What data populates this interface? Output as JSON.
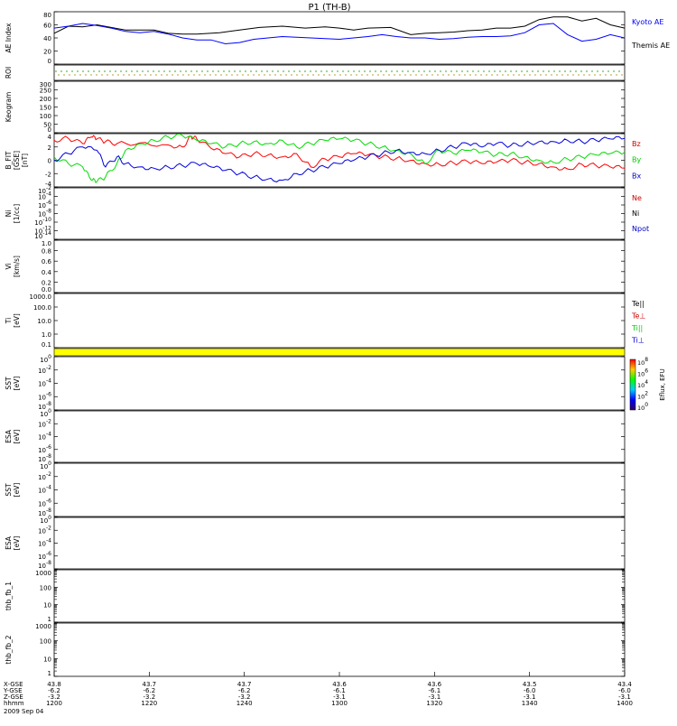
{
  "title": "P1 (TH-B)",
  "chart_data": {
    "type": "line",
    "x_range": [
      1200,
      1400
    ],
    "panels": [
      {
        "ylabel": [
          "AE Index"
        ],
        "kind": "ae",
        "ticks": [
          "80",
          "60",
          "40",
          "20",
          "0"
        ],
        "legend": [
          {
            "label": "Kyoto AE",
            "color": "#0000ff"
          },
          {
            "label": "Themis AE",
            "color": "#000000"
          }
        ],
        "series": [
          {
            "color": "#000000",
            "x": [
              1200,
              1205,
              1210,
              1215,
              1225,
              1235,
              1240,
              1245,
              1250,
              1258,
              1265,
              1272,
              1280,
              1288,
              1295,
              1300,
              1305,
              1310,
              1318,
              1325,
              1330,
              1335,
              1340,
              1345,
              1350,
              1355,
              1360,
              1365,
              1370,
              1375,
              1380,
              1385,
              1390,
              1395,
              1400
            ],
            "y": [
              47,
              58,
              57,
              60,
              52,
              52,
              47,
              46,
              46,
              48,
              52,
              56,
              58,
              55,
              57,
              55,
              52,
              55,
              56,
              45,
              47,
              48,
              49,
              51,
              52,
              55,
              55,
              58,
              68,
              72,
              72,
              66,
              70,
              60,
              55
            ]
          },
          {
            "color": "#0000ff",
            "x": [
              1200,
              1205,
              1210,
              1215,
              1220,
              1225,
              1230,
              1235,
              1240,
              1245,
              1250,
              1255,
              1260,
              1265,
              1270,
              1275,
              1280,
              1285,
              1290,
              1295,
              1300,
              1305,
              1310,
              1315,
              1320,
              1325,
              1330,
              1335,
              1340,
              1345,
              1350,
              1355,
              1360,
              1365,
              1370,
              1375,
              1380,
              1385,
              1390,
              1395,
              1400
            ],
            "y": [
              55,
              58,
              62,
              59,
              55,
              50,
              48,
              50,
              46,
              40,
              37,
              37,
              31,
              33,
              38,
              40,
              42,
              41,
              40,
              39,
              38,
              40,
              42,
              45,
              42,
              40,
              40,
              38,
              39,
              41,
              42,
              42,
              43,
              48,
              60,
              62,
              45,
              35,
              38,
              45,
              40
            ]
          }
        ]
      },
      {
        "ylabel": [
          "ROI"
        ],
        "kind": "roi"
      },
      {
        "ylabel": [
          "Keogram"
        ],
        "kind": "keogram",
        "ticks": [
          "300",
          "250",
          "200",
          "150",
          "100",
          "50",
          "0"
        ]
      },
      {
        "ylabel": [
          "B_FIT",
          "[GSE]",
          "[nT]"
        ],
        "kind": "bfit",
        "ticks": [
          "4",
          "2",
          "0",
          "-2",
          "-4"
        ],
        "legend": [
          {
            "label": "Bz",
            "color": "#cc0000"
          },
          {
            "label": "By",
            "color": "#00cc00"
          },
          {
            "label": "Bx",
            "color": "#0000cc"
          }
        ],
        "series": [
          {
            "color": "#ff0000",
            "x": [
              1200,
              1205,
              1210,
              1213,
              1215,
              1218,
              1222,
              1230,
              1240,
              1245,
              1248,
              1250,
              1255,
              1260,
              1265,
              1270,
              1275,
              1280,
              1285,
              1290,
              1295,
              1300,
              1305,
              1310,
              1315,
              1320,
              1325,
              1330,
              1335,
              1340,
              1345,
              1350,
              1355,
              1360,
              1365,
              1370,
              1375,
              1380,
              1385,
              1390,
              1395,
              1400
            ],
            "y": [
              3.0,
              3.3,
              2.5,
              3.5,
              3.2,
              2.8,
              2.5,
              2.6,
              2.3,
              2.0,
              3.6,
              3.2,
              1.8,
              1.0,
              0.5,
              1.0,
              0.8,
              0.5,
              1.0,
              -1.0,
              0.2,
              0.5,
              1.0,
              0.8,
              0.5,
              0.3,
              0.0,
              -0.5,
              -0.6,
              -0.4,
              -0.2,
              -0.5,
              -0.3,
              0.0,
              -0.3,
              -0.5,
              -1.0,
              -1.3,
              -0.6,
              -0.8,
              -1.0,
              -1.2
            ]
          },
          {
            "color": "#00dd00",
            "x": [
              1200,
              1205,
              1210,
              1213,
              1215,
              1218,
              1222,
              1225,
              1230,
              1235,
              1240,
              1245,
              1250,
              1255,
              1260,
              1265,
              1270,
              1275,
              1280,
              1285,
              1290,
              1295,
              1300,
              1305,
              1310,
              1315,
              1320,
              1325,
              1330,
              1335,
              1340,
              1345,
              1350,
              1355,
              1360,
              1365,
              1370,
              1375,
              1380,
              1385,
              1390,
              1395,
              1400
            ],
            "y": [
              0.5,
              -0.5,
              -1.0,
              -3.0,
              -3.2,
              -2.5,
              -0.5,
              1.5,
              2.5,
              3.0,
              3.5,
              3.7,
              3.0,
              2.5,
              2.0,
              2.5,
              2.8,
              2.5,
              3.0,
              2.0,
              2.5,
              3.0,
              3.2,
              3.0,
              2.5,
              2.0,
              1.5,
              1.0,
              -0.5,
              1.5,
              1.0,
              1.5,
              1.2,
              0.8,
              1.0,
              0.5,
              0.0,
              -0.3,
              0.2,
              0.5,
              0.8,
              1.0,
              1.2
            ]
          },
          {
            "color": "#0000dd",
            "x": [
              1200,
              1205,
              1210,
              1215,
              1218,
              1222,
              1225,
              1230,
              1235,
              1240,
              1245,
              1250,
              1255,
              1260,
              1265,
              1270,
              1275,
              1280,
              1285,
              1290,
              1295,
              1300,
              1305,
              1310,
              1315,
              1320,
              1325,
              1330,
              1335,
              1340,
              1345,
              1350,
              1355,
              1360,
              1365,
              1370,
              1375,
              1380,
              1385,
              1390,
              1395,
              1400
            ],
            "y": [
              0.0,
              1.0,
              2.0,
              1.5,
              -1.0,
              0.5,
              -0.5,
              -1.0,
              -1.2,
              -1.0,
              -0.8,
              -0.5,
              -1.0,
              -1.5,
              -2.0,
              -2.5,
              -2.8,
              -3.0,
              -2.0,
              -1.5,
              -1.0,
              -0.5,
              0.0,
              0.5,
              1.0,
              1.5,
              1.2,
              1.0,
              1.5,
              2.0,
              2.5,
              2.0,
              2.5,
              2.2,
              2.5,
              2.8,
              2.8,
              3.0,
              2.8,
              3.0,
              3.2,
              3.3
            ]
          }
        ]
      },
      {
        "ylabel": [
          "Ni",
          "[1/cc]"
        ],
        "kind": "ni",
        "ticks": [
          "10^{-2}",
          "10^{-4}",
          "10^{-6}",
          "10^{-8}",
          "10^{-10}",
          "10^{-12}",
          "10^{-14}"
        ],
        "legend": [
          {
            "label": "Ne",
            "color": "#cc0000"
          },
          {
            "label": "Ni",
            "color": "#000000"
          },
          {
            "label": "Npot",
            "color": "#0000cc"
          }
        ]
      },
      {
        "ylabel": [
          "Vi",
          "[km/s]"
        ],
        "kind": "vi",
        "ticks": [
          "1.0",
          "0.8",
          "0.6",
          "0.4",
          "0.2",
          "0.0"
        ]
      },
      {
        "ylabel": [
          "Ti",
          "[eV]"
        ],
        "kind": "ti",
        "ticks": [
          "1000.0",
          "100.0",
          "10.0",
          "1.0",
          "0.1"
        ],
        "legend": [
          {
            "label": "Te||",
            "color": "#000000"
          },
          {
            "label": "Te⊥",
            "color": "#cc0000"
          },
          {
            "label": "Ti||",
            "color": "#00cc00"
          },
          {
            "label": "Ti⊥",
            "color": "#0000cc"
          }
        ]
      },
      {
        "kind": "bar"
      },
      {
        "ylabel": [
          "SST",
          "[eV]"
        ],
        "kind": "spec",
        "ticks": [
          "10^{0}",
          "10^{-2}",
          "10^{-4}",
          "10^{-6}",
          "10^{-8}"
        ],
        "colorbar": {
          "label": "Eflux, EFU",
          "ticks": [
            "10^{8}",
            "10^{6}",
            "10^{4}",
            "10^{2}",
            "10^{0}"
          ]
        }
      },
      {
        "ylabel": [
          "ESA",
          "[eV]"
        ],
        "kind": "spec",
        "ticks": [
          "10^{0}",
          "10^{-2}",
          "10^{-4}",
          "10^{-6}",
          "10^{-8}"
        ]
      },
      {
        "ylabel": [
          "SST",
          "[eV]"
        ],
        "kind": "spec",
        "ticks": [
          "10^{0}",
          "10^{-2}",
          "10^{-4}",
          "10^{-6}",
          "10^{-8}"
        ]
      },
      {
        "ylabel": [
          "ESA",
          "[eV]"
        ],
        "kind": "spec",
        "ticks": [
          "10^{0}",
          "10^{-2}",
          "10^{-4}",
          "10^{-6}",
          "10^{-8}"
        ]
      },
      {
        "ylabel": [
          "thb_fb_1"
        ],
        "kind": "fb",
        "ticks": [
          "1000",
          "100",
          "10",
          "1"
        ]
      },
      {
        "ylabel": [
          "thb_fb_2"
        ],
        "kind": "fb",
        "ticks": [
          "1000",
          "100",
          "10",
          "1"
        ]
      }
    ],
    "x_axis": {
      "row_labels": [
        "X-GSE",
        "Y-GSE",
        "Z-GSE",
        "hhmm",
        "2009 Sep 04"
      ],
      "columns": [
        {
          "values": [
            "43.8",
            "-6.2",
            "-3.2",
            "1200"
          ]
        },
        {
          "values": [
            "43.7",
            "-6.2",
            "-3.2",
            "1220"
          ]
        },
        {
          "values": [
            "43.7",
            "-6.2",
            "-3.2",
            "1240"
          ]
        },
        {
          "values": [
            "43.6",
            "-6.1",
            "-3.1",
            "1300"
          ]
        },
        {
          "values": [
            "43.6",
            "-6.1",
            "-3.1",
            "1320"
          ]
        },
        {
          "values": [
            "43.5",
            "-6.0",
            "-3.1",
            "1340"
          ]
        },
        {
          "values": [
            "43.4",
            "-6.0",
            "-3.1",
            "1400"
          ]
        }
      ]
    }
  }
}
